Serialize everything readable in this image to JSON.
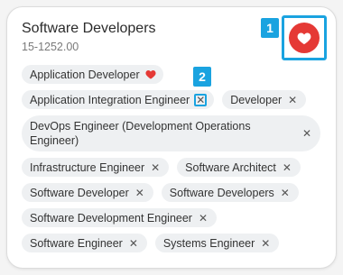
{
  "card": {
    "title": "Software Developers",
    "code": "15-1252.00",
    "favorite_icon": "heart-icon",
    "favorite_color": "#e53935"
  },
  "annotations": {
    "badge1": "1",
    "badge2": "2",
    "highlight_color": "#1aa3e0"
  },
  "chips": [
    {
      "label": "Application Developer",
      "icon": "heart-icon"
    },
    {
      "label": "Application Integration Engineer",
      "icon": "close-icon"
    },
    {
      "label": "Developer",
      "icon": "close-icon"
    },
    {
      "label": "DevOps Engineer (Development Operations Engineer)",
      "icon": "close-icon"
    },
    {
      "label": "Infrastructure Engineer",
      "icon": "close-icon"
    },
    {
      "label": "Software Architect",
      "icon": "close-icon"
    },
    {
      "label": "Software Developer",
      "icon": "close-icon"
    },
    {
      "label": "Software Developers",
      "icon": "close-icon"
    },
    {
      "label": "Software Development Engineer",
      "icon": "close-icon"
    },
    {
      "label": "Software Engineer",
      "icon": "close-icon"
    },
    {
      "label": "Systems Engineer",
      "icon": "close-icon"
    }
  ]
}
